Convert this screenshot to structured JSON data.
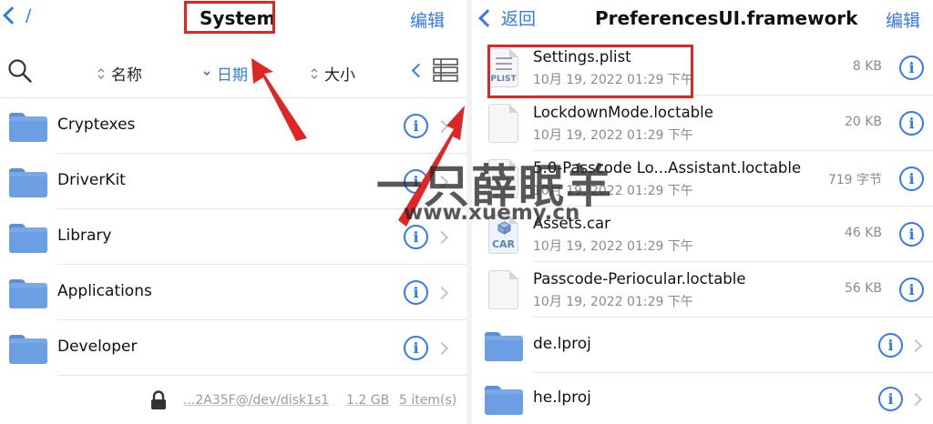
{
  "left": {
    "nav": {
      "back_text": "/",
      "title": "System",
      "edit": "编辑"
    },
    "sort": {
      "name": "名称",
      "date": "日期",
      "size": "大小"
    },
    "items": [
      {
        "name": "Cryptexes"
      },
      {
        "name": "DriverKit"
      },
      {
        "name": "Library"
      },
      {
        "name": "Applications"
      },
      {
        "name": "Developer"
      }
    ],
    "status": {
      "volume": "...2A35F@/dev/disk1s1",
      "capacity": "1.2 GB",
      "count": "5 item(s)"
    }
  },
  "right": {
    "nav": {
      "back": "返回",
      "title": "PreferencesUI.framework",
      "edit": "编辑"
    },
    "files": [
      {
        "name": "Settings.plist",
        "date": "10月 19, 2022 01:29 下午",
        "size": "8 KB",
        "icon_label": "PLIST"
      },
      {
        "name": "LockdownMode.loctable",
        "date": "10月 19, 2022 01:29 下午",
        "size": "20 KB",
        "icon_label": ""
      },
      {
        "name": "5.0-Passcode Lo...Assistant.loctable",
        "date": "10月 19, 2022 01:29 下午",
        "size": "719 字节",
        "icon_label": ""
      },
      {
        "name": "Assets.car",
        "date": "10月 19, 2022 01:29 下午",
        "size": "46 KB",
        "icon_label": "CAR"
      },
      {
        "name": "Passcode-Periocular.loctable",
        "date": "10月 19, 2022 01:29 下午",
        "size": "56 KB",
        "icon_label": ""
      }
    ],
    "folders": [
      {
        "name": "de.lproj"
      },
      {
        "name": "he.lproj"
      }
    ]
  },
  "watermark": {
    "cn": "一只薛眠羊",
    "url": "www.xuemy.cn"
  },
  "colors": {
    "accent": "#3478f6",
    "annotation": "#e02525",
    "folder": "#7aa9e8"
  },
  "icons": [
    "chevron-left-icon",
    "search-icon",
    "sort-updown-icon",
    "chevron-down-icon",
    "grid-list-icon",
    "folder-icon",
    "info-icon",
    "chevron-right-icon",
    "file-icon",
    "lock-icon"
  ]
}
